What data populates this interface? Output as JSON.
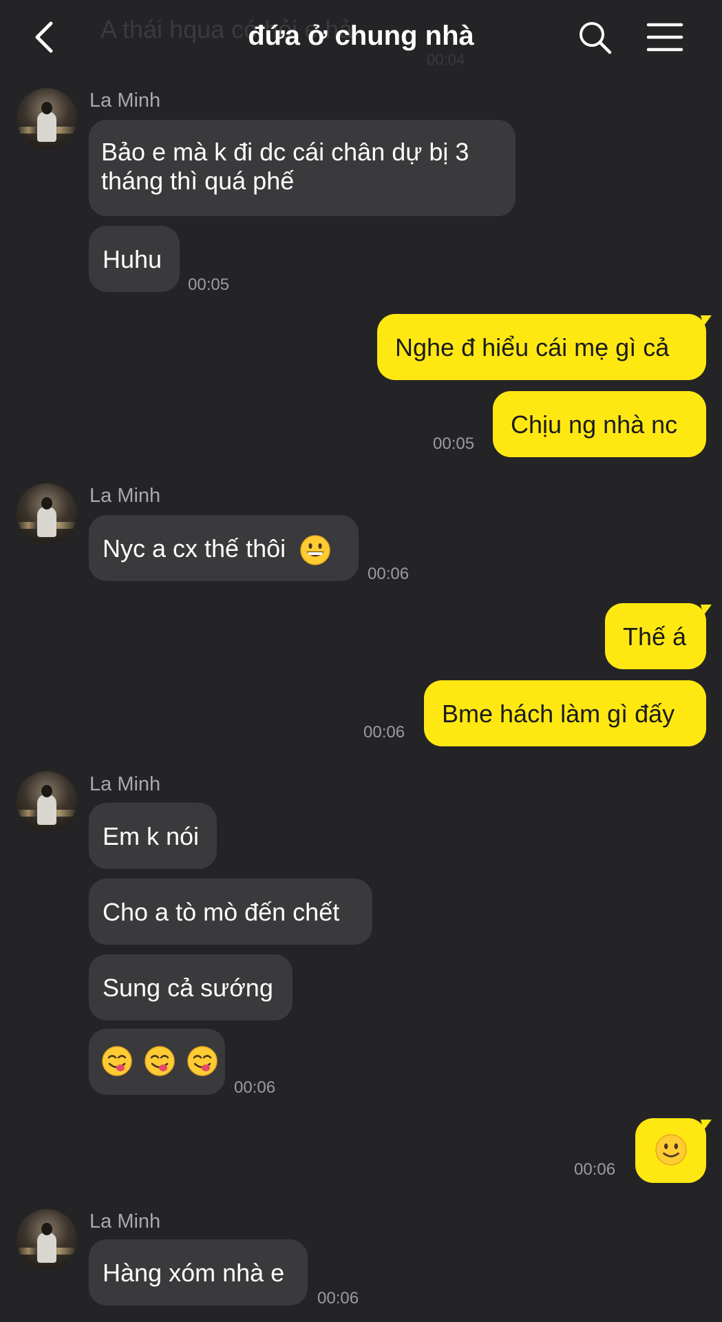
{
  "header": {
    "title": "đứa ở chung nhà",
    "ghost_text": "A thái hqua có hỏi e hả",
    "ghost_time": "00:04"
  },
  "colors": {
    "background": "#242426",
    "incoming_bubble": "#3a3a3c",
    "outgoing_bubble": "#ffe812",
    "timestamp": "#9c9ca0"
  },
  "icons": {
    "back": "chevron-left-icon",
    "search": "search-icon",
    "menu": "hamburger-menu-icon",
    "grin": "grinning-face-emoji",
    "yum": "face-savoring-food-emoji",
    "smile": "slightly-smiling-face-emoji"
  },
  "messages": {
    "g1_sender": "La Minh",
    "m1": "Bảo e mà k đi dc cái chân dự bị 3 tháng thì quá phế",
    "m2": "Huhu",
    "m2_time": "00:05",
    "m3": "Nghe đ hiểu cái mẹ gì cả",
    "m4": "Chịu ng nhà nc",
    "m4_time": "00:05",
    "g2_sender": "La Minh",
    "m5": "Nyc a cx thế thôi",
    "m5_time": "00:06",
    "m6": "Thế á",
    "m7": "Bme hách làm gì đấy",
    "m7_time": "00:06",
    "g3_sender": "La Minh",
    "m8": "Em k nói",
    "m9": "Cho a tò mò đến chết",
    "m10": "Sung cả sướng",
    "m11_time": "00:06",
    "m12_time": "00:06",
    "g4_sender": "La Minh",
    "m13": "Hàng xóm nhà e",
    "m13_time": "00:06"
  }
}
